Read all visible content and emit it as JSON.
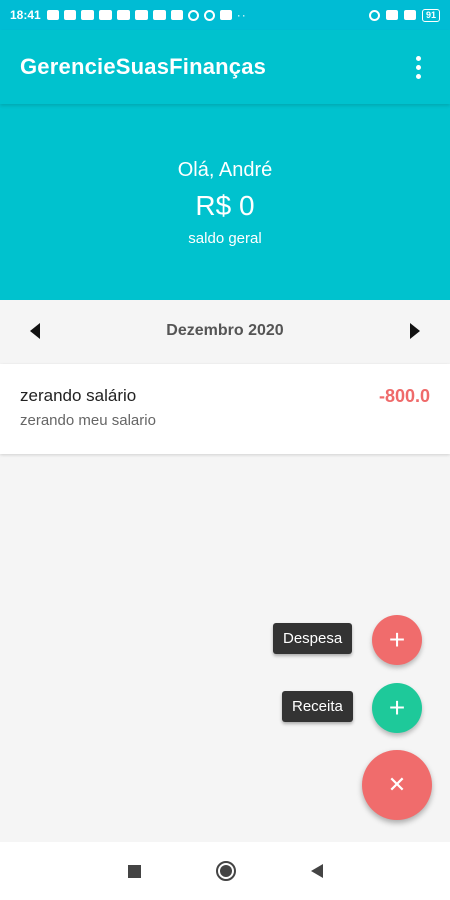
{
  "status_bar": {
    "time": "18:41",
    "battery": "91"
  },
  "app_bar": {
    "title": "GerencieSuasFinanças"
  },
  "header": {
    "greeting": "Olá, André",
    "balance": "R$ 0",
    "balance_label": "saldo geral"
  },
  "month_selector": {
    "label": "Dezembro 2020"
  },
  "transactions": [
    {
      "title": "zerando salário",
      "description": "zerando meu salario",
      "amount": "-800.0",
      "amount_color": "#ef6a6a"
    }
  ],
  "fab": {
    "expense_label": "Despesa",
    "income_label": "Receita",
    "expense_color": "#f06c6c",
    "income_color": "#1ec99a",
    "add_icon": "plus-icon",
    "close_icon": "close-icon"
  },
  "colors": {
    "primary": "#00c2ce",
    "accent": "#f06c6c"
  }
}
